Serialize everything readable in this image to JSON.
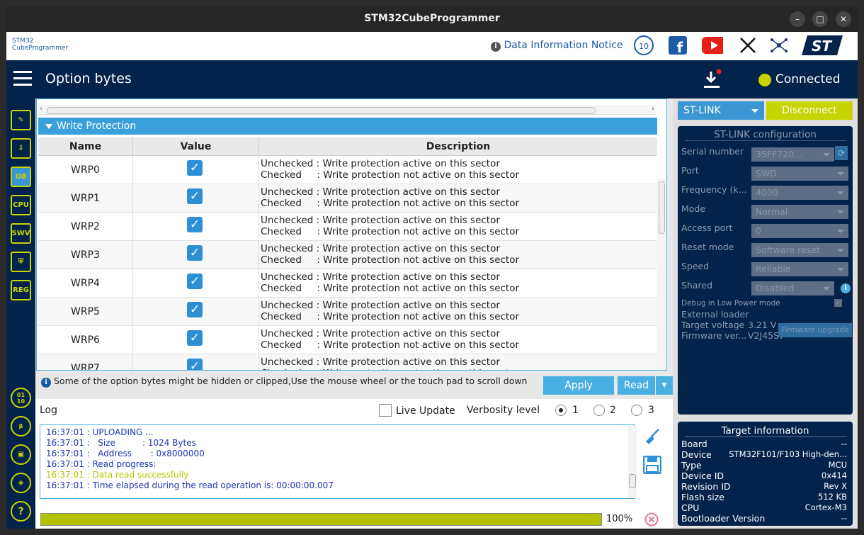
{
  "window": {
    "title": "STM32CubeProgrammer"
  },
  "topbar": {
    "logo_line1": "STM32",
    "logo_line2": "CubeProgrammer",
    "notice": "Data Information Notice",
    "anniversary": "10"
  },
  "header": {
    "title": "Option bytes",
    "status": "Connected"
  },
  "sidebar": {
    "items": [
      "edit",
      "download",
      "OB",
      "CPU",
      "SWV",
      "security",
      "REG",
      "0110",
      "beta",
      "chip",
      "cube",
      "?"
    ]
  },
  "table": {
    "section": "Write Protection",
    "columns": [
      "Name",
      "Value",
      "Description"
    ],
    "rows": [
      {
        "name": "WRP0",
        "line1": "Unchecked : Write protection active on this sector",
        "line2": "Checked     : Write protection not active on this sector"
      },
      {
        "name": "WRP1",
        "line1": "Unchecked : Write protection active on this sector",
        "line2": "Checked     : Write protection not active on this sector"
      },
      {
        "name": "WRP2",
        "line1": "Unchecked : Write protection active on this sector",
        "line2": "Checked     : Write protection not active on this sector"
      },
      {
        "name": "WRP3",
        "line1": "Unchecked : Write protection active on this sector",
        "line2": "Checked     : Write protection not active on this sector"
      },
      {
        "name": "WRP4",
        "line1": "Unchecked : Write protection active on this sector",
        "line2": "Checked     : Write protection not active on this sector"
      },
      {
        "name": "WRP5",
        "line1": "Unchecked : Write protection active on this sector",
        "line2": "Checked     : Write protection not active on this sector"
      },
      {
        "name": "WRP6",
        "line1": "Unchecked : Write protection active on this sector",
        "line2": "Checked     : Write protection not active on this sector"
      },
      {
        "name": "WRP7",
        "line1": "Unchecked : Write protection active on this sector",
        "line2": "Checked     : Write protection not active on this sector"
      }
    ]
  },
  "info": "Some of the option bytes might be hidden or clipped,Use the mouse wheel or the touch pad to scroll down",
  "buttons": {
    "apply": "Apply",
    "read": "Read"
  },
  "log": {
    "title": "Log",
    "live_update": "Live Update",
    "verbosity_label": "Verbosity level",
    "levels": [
      "1",
      "2",
      "3"
    ],
    "lines": [
      "16:37:01 : UPLOADING ...",
      "16:37:01 :   Size          : 1024 Bytes",
      "16:37:01 :   Address       : 0x8000000",
      "16:37:01 : Read progress:",
      "16:37:01 : Data read successfully",
      "16:37:01 : Time elapsed during the read operation is: 00:00:00.007"
    ],
    "progress_text": "100%",
    "progress": 1.0
  },
  "right": {
    "probe": "ST-LINK",
    "disconnect": "Disconnect",
    "config_title": "ST-LINK configuration",
    "config": [
      {
        "label": "Serial number",
        "value": "35FF720..."
      },
      {
        "label": "Port",
        "value": "SWD"
      },
      {
        "label": "Frequency (k...",
        "value": "4000"
      },
      {
        "label": "Mode",
        "value": "Normal"
      },
      {
        "label": "Access port",
        "value": "0"
      },
      {
        "label": "Reset mode",
        "value": "Software reset"
      },
      {
        "label": "Speed",
        "value": "Reliable"
      },
      {
        "label": "Shared",
        "value": "Disabled"
      }
    ],
    "debug_low_power": "Debug in Low Power mode",
    "external_loader": "External loader",
    "target_voltage_label": "Target voltage",
    "target_voltage": "3.21 V",
    "firmware_label": "Firmware ver...",
    "firmware": "V2J45S7",
    "firmware_upgrade": "Firmware upgrade",
    "target_title": "Target information",
    "target": [
      {
        "label": "Board",
        "value": "--"
      },
      {
        "label": "Device",
        "value": "STM32F101/F103 High-den..."
      },
      {
        "label": "Type",
        "value": "MCU"
      },
      {
        "label": "Device ID",
        "value": "0x414"
      },
      {
        "label": "Revision ID",
        "value": "Rev X"
      },
      {
        "label": "Flash size",
        "value": "512 KB"
      },
      {
        "label": "CPU",
        "value": "Cortex-M3"
      },
      {
        "label": "Bootloader Version",
        "value": "--"
      }
    ]
  },
  "colors": {
    "navy": "#03234b",
    "accent": "#c8d400",
    "blue": "#3b97d3"
  }
}
